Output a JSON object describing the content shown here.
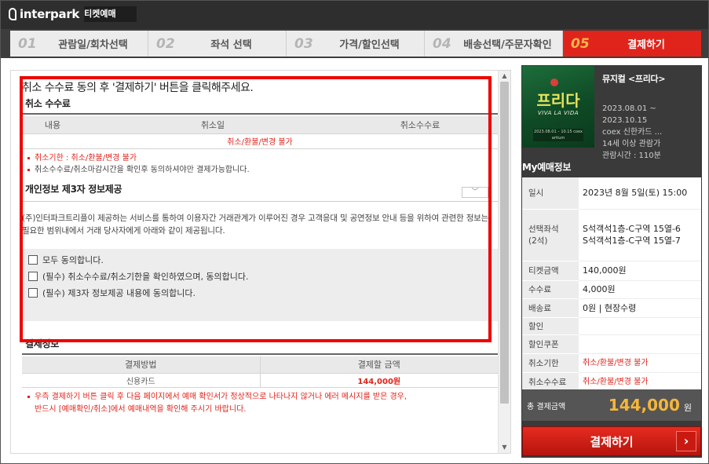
{
  "header": {
    "brand": "interpark",
    "service": "티켓예매"
  },
  "steps": [
    {
      "num": "01",
      "label": "관람일/회차선택"
    },
    {
      "num": "02",
      "label": "좌석 선택"
    },
    {
      "num": "03",
      "label": "가격/할인선택"
    },
    {
      "num": "04",
      "label": "배송선택/주문자확인"
    },
    {
      "num": "05",
      "label": "결제하기"
    }
  ],
  "main": {
    "cut_instruction": "취소 수수료 동의 후 '결제하기' 버튼을 클릭해주세요.",
    "cancel_fee": {
      "title": "취소 수수료",
      "columns": [
        "내용",
        "취소일",
        "취소수수료"
      ],
      "row_text": "취소/환불/변경 불가",
      "notes": [
        "취소기한 : 취소/환불/변경 불가",
        "취소수수료/취소마감시간을 확인후 동의하셔야만 결제가능합니다."
      ]
    },
    "privacy": {
      "title": "개인정보 제3자 정보제공",
      "toggle_icon": "﹀",
      "text": "(주)인터파크트리플이 제공하는 서비스를 통하여 이용자간 거래관계가 이루어진 경우 고객응대 및 공연정보 안내 등을 위하여 관련한 정보는 필요한 범위내에서 거래 당사자에게 아래와 같이 제공됩니다."
    },
    "agreements": [
      "모두 동의합니다.",
      "(필수) 취소수수료/취소기한을 확인하였으며, 동의합니다.",
      "(필수) 제3자 정보제공 내용에 동의합니다."
    ],
    "payment_info": {
      "title": "결제정보",
      "columns": [
        "결제방법",
        "결제할 금액"
      ],
      "method": "신용카드",
      "amount": "144,000원"
    },
    "bottom_notes": [
      "우측 결제하기 버튼 클릭 후 다음 페이지에서 예매 확인서가 정상적으로 나타나지 않거나 에러 메시지를 받은 경우,",
      "반드시 [예매확인/취소]에서 예매내역을 확인해 주시기 바랍니다."
    ]
  },
  "sidebar": {
    "poster": {
      "title": "프리다",
      "subtitle": "VIVA LA VIDA",
      "info": "2023.08.01 – 10.15 coex artium"
    },
    "show_title": "뮤지컬 <프리다>",
    "show_info": [
      "2023.08.01 ~",
      "2023.10.15",
      "coex 신한카드 ...",
      "14세 이상 관람가",
      "관람시간 : 110분"
    ],
    "my_title": "My예매정보",
    "rows": [
      {
        "label": "일시",
        "value": "2023년 8월 5일(토) 15:00"
      },
      {
        "label": "선택좌석\n(2석)",
        "value": "S석객석1층-C구역 15열-6\nS석객석1층-C구역 15열-7"
      },
      {
        "label": "티켓금액",
        "value": "140,000원"
      },
      {
        "label": "수수료",
        "value": "4,000원"
      },
      {
        "label": "배송료",
        "value": "0원 | 현장수령"
      },
      {
        "label": "할인",
        "value": ""
      },
      {
        "label": "할인쿠폰",
        "value": ""
      },
      {
        "label": "취소기한",
        "value": "취소/환불/변경 불가"
      },
      {
        "label": "취소수수료",
        "value": "취소/환불/변경 불가"
      }
    ],
    "total_label": "총 결제금액",
    "total_value": "144,000",
    "total_unit": "원",
    "pay_button": "결제하기",
    "pay_arrow": "›"
  },
  "colors": {
    "accent_red": "#e0241b",
    "total_gold": "#f5b63b",
    "highlight": "#ee0000"
  }
}
